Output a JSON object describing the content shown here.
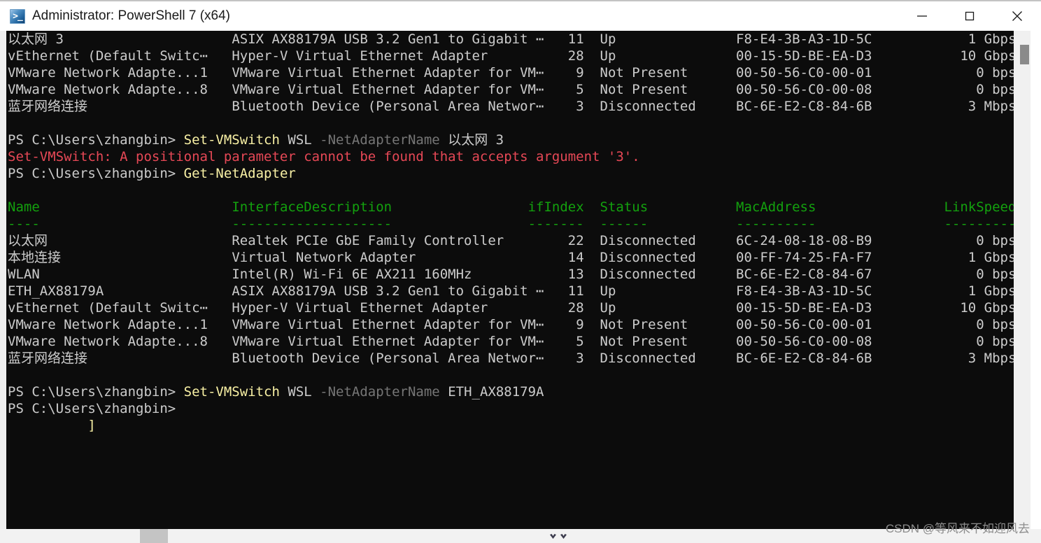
{
  "window": {
    "title": "Administrator: PowerShell 7 (x64)",
    "icon": "powershell-icon",
    "minimize_label": "—",
    "maximize_label": "□",
    "close_label": "✕",
    "background": "#0c0c0c",
    "foreground": "#cccccc"
  },
  "colors": {
    "default": "#cccccc",
    "header": "#13a10e",
    "cmdlet": "#f9f1a5",
    "parameter": "#767676",
    "error": "#e74856",
    "terminal_bg": "#0c0c0c"
  },
  "prompt": {
    "prefix": "PS C:\\Users\\zhangbin>"
  },
  "table_headers": {
    "name": "Name",
    "interface_description": "InterfaceDescription",
    "ifindex": "ifIndex",
    "status": "Status",
    "mac_address": "MacAddress",
    "link_speed": "LinkSpeed",
    "underline_name": "----",
    "underline_desc": "--------------------",
    "underline_ifindex": "-------",
    "underline_status": "------",
    "underline_mac": "----------",
    "underline_speed": "---------"
  },
  "scrollback_rows": [
    {
      "name": "以太网 3",
      "description": "ASIX AX88179A USB 3.2 Gen1 to Gigabit ⋯",
      "ifindex": "11",
      "status": "Up",
      "mac": "F8-E4-3B-A3-1D-5C",
      "speed": "1 Gbps"
    },
    {
      "name": "vEthernet (Default Switc⋯",
      "description": "Hyper-V Virtual Ethernet Adapter",
      "ifindex": "28",
      "status": "Up",
      "mac": "00-15-5D-BE-EA-D3",
      "speed": "10 Gbps"
    },
    {
      "name": "VMware Network Adapte...1",
      "description": "VMware Virtual Ethernet Adapter for VM⋯",
      "ifindex": "9",
      "status": "Not Present",
      "mac": "00-50-56-C0-00-01",
      "speed": "0 bps"
    },
    {
      "name": "VMware Network Adapte...8",
      "description": "VMware Virtual Ethernet Adapter for VM⋯",
      "ifindex": "5",
      "status": "Not Present",
      "mac": "00-50-56-C0-00-08",
      "speed": "0 bps"
    },
    {
      "name": "蓝牙网络连接",
      "description": "Bluetooth Device (Personal Area Networ⋯",
      "ifindex": "3",
      "status": "Disconnected",
      "mac": "BC-6E-E2-C8-84-6B",
      "speed": "3 Mbps"
    }
  ],
  "command_1": {
    "cmdlet": "Set-VMSwitch",
    "arg": "WSL",
    "parameter": "-NetAdapterName",
    "value": "以太网 3"
  },
  "error_message": "Set-VMSwitch: A positional parameter cannot be found that accepts argument '3'.",
  "command_2": {
    "cmdlet": "Get-NetAdapter"
  },
  "adapter_rows": [
    {
      "name": "以太网",
      "description": "Realtek PCIe GbE Family Controller",
      "ifindex": "22",
      "status": "Disconnected",
      "mac": "6C-24-08-18-08-B9",
      "speed": "0 bps"
    },
    {
      "name": "本地连接",
      "description": "Virtual Network Adapter",
      "ifindex": "14",
      "status": "Disconnected",
      "mac": "00-FF-74-25-FA-F7",
      "speed": "1 Gbps"
    },
    {
      "name": "WLAN",
      "description": "Intel(R) Wi-Fi 6E AX211 160MHz",
      "ifindex": "13",
      "status": "Disconnected",
      "mac": "BC-6E-E2-C8-84-67",
      "speed": "0 bps"
    },
    {
      "name": "ETH_AX88179A",
      "description": "ASIX AX88179A USB 3.2 Gen1 to Gigabit ⋯",
      "ifindex": "11",
      "status": "Up",
      "mac": "F8-E4-3B-A3-1D-5C",
      "speed": "1 Gbps"
    },
    {
      "name": "vEthernet (Default Switc⋯",
      "description": "Hyper-V Virtual Ethernet Adapter",
      "ifindex": "28",
      "status": "Up",
      "mac": "00-15-5D-BE-EA-D3",
      "speed": "10 Gbps"
    },
    {
      "name": "VMware Network Adapte...1",
      "description": "VMware Virtual Ethernet Adapter for VM⋯",
      "ifindex": "9",
      "status": "Not Present",
      "mac": "00-50-56-C0-00-01",
      "speed": "0 bps"
    },
    {
      "name": "VMware Network Adapte...8",
      "description": "VMware Virtual Ethernet Adapter for VM⋯",
      "ifindex": "5",
      "status": "Not Present",
      "mac": "00-50-56-C0-00-08",
      "speed": "0 bps"
    },
    {
      "name": "蓝牙网络连接",
      "description": "Bluetooth Device (Personal Area Networ⋯",
      "ifindex": "3",
      "status": "Disconnected",
      "mac": "BC-6E-E2-C8-84-6B",
      "speed": "3 Mbps"
    }
  ],
  "command_3": {
    "cmdlet": "Set-VMSwitch",
    "arg": "WSL",
    "parameter": "-NetAdapterName",
    "value": "ETH_AX88179A"
  },
  "trailing_artifact": "]",
  "watermark": "CSDN @等风来不如迎风去"
}
